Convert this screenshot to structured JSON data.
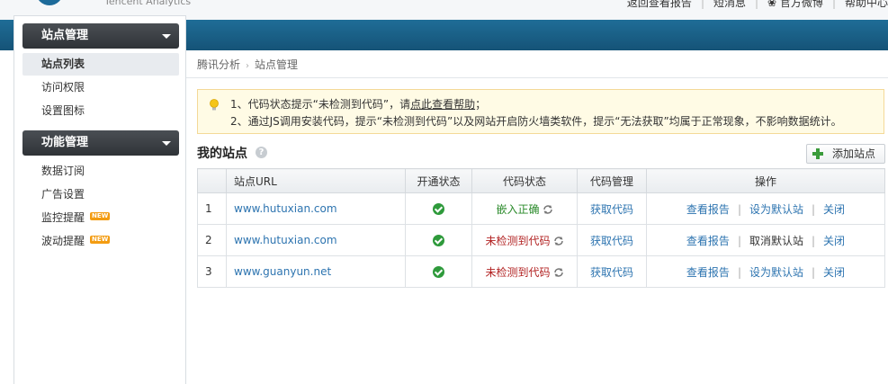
{
  "header": {
    "logo_text": "Tencent Analytics",
    "links": [
      "返回查看报告",
      "短消息",
      "官方微博",
      "帮助中心"
    ]
  },
  "sidebar": {
    "sections": [
      {
        "title": "站点管理",
        "items": [
          {
            "label": "站点列表",
            "active": true,
            "badge": ""
          },
          {
            "label": "访问权限",
            "active": false,
            "badge": ""
          },
          {
            "label": "设置图标",
            "active": false,
            "badge": ""
          }
        ]
      },
      {
        "title": "功能管理",
        "items": [
          {
            "label": "数据订阅",
            "active": false,
            "badge": ""
          },
          {
            "label": "广告设置",
            "active": false,
            "badge": ""
          },
          {
            "label": "监控提醒",
            "active": false,
            "badge": "NEW"
          },
          {
            "label": "波动提醒",
            "active": false,
            "badge": "NEW"
          }
        ]
      }
    ]
  },
  "breadcrumb": [
    "腾讯分析",
    "站点管理"
  ],
  "notice": {
    "line1_prefix": "1、代码状态提示“未检测到代码”，请",
    "line1_link": "点此查看帮助",
    "line1_suffix": "；",
    "line2": "2、通过JS调用安装代码，提示“未检测到代码”以及网站开启防火墙类软件，提示“无法获取”均属于正常现象，不影响数据统计。"
  },
  "main": {
    "title": "我的站点",
    "help_glyph": "?",
    "add_button": "添加站点"
  },
  "table": {
    "columns": [
      "",
      "站点URL",
      "开通状态",
      "代码状态",
      "代码管理",
      "操作"
    ],
    "rows": [
      {
        "index": "1",
        "url": "www.hutuxian.com",
        "code_status": "嵌入正确",
        "code_ok": true,
        "code_action": "获取代码",
        "op1": "查看报告",
        "op2": "设为默认站",
        "op3": "关闭"
      },
      {
        "index": "2",
        "url": "www.hutuxian.com",
        "code_status": "未检测到代码",
        "code_ok": false,
        "code_action": "获取代码",
        "op1": "查看报告",
        "op2": "取消默认站",
        "op3": "关闭"
      },
      {
        "index": "3",
        "url": "www.guanyun.net",
        "code_status": "未检测到代码",
        "code_ok": false,
        "code_action": "获取代码",
        "op1": "查看报告",
        "op2": "设为默认站",
        "op3": "关闭"
      }
    ]
  },
  "colors": {
    "accent_blue": "#1f6d97",
    "link_blue": "#2d74b0",
    "ok_green": "#2e9a3b",
    "error_red": "#b22222"
  }
}
